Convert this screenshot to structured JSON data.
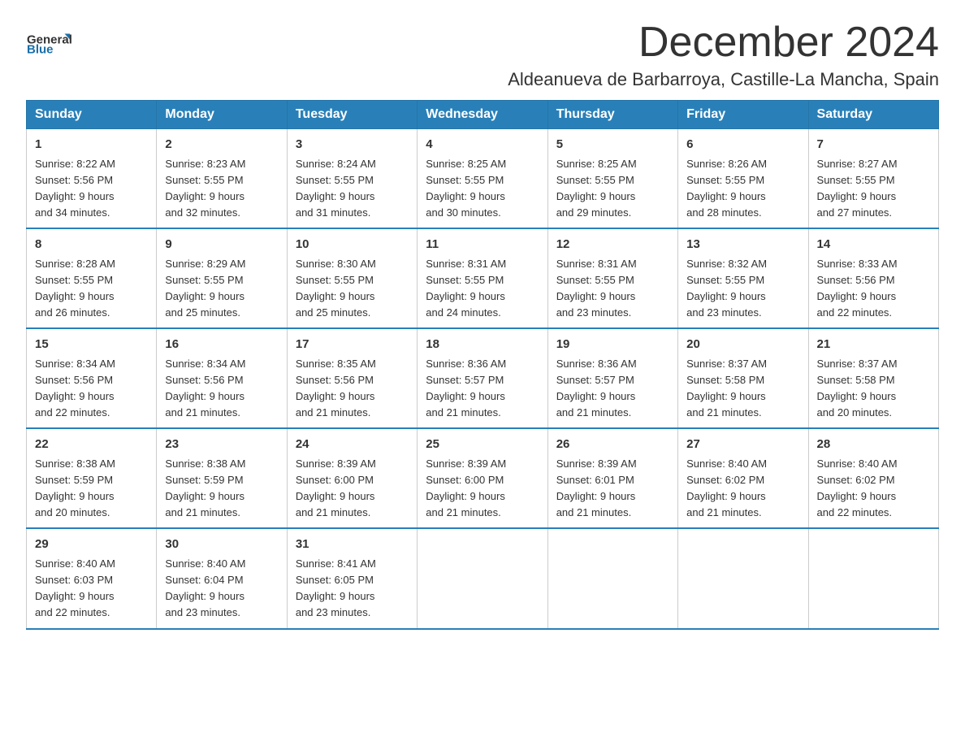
{
  "header": {
    "logo_general": "General",
    "logo_blue": "Blue",
    "month_title": "December 2024",
    "location": "Aldeanueva de Barbarroya, Castille-La Mancha, Spain"
  },
  "weekdays": [
    "Sunday",
    "Monday",
    "Tuesday",
    "Wednesday",
    "Thursday",
    "Friday",
    "Saturday"
  ],
  "weeks": [
    [
      {
        "day": "1",
        "sunrise": "8:22 AM",
        "sunset": "5:56 PM",
        "daylight": "9 hours and 34 minutes."
      },
      {
        "day": "2",
        "sunrise": "8:23 AM",
        "sunset": "5:55 PM",
        "daylight": "9 hours and 32 minutes."
      },
      {
        "day": "3",
        "sunrise": "8:24 AM",
        "sunset": "5:55 PM",
        "daylight": "9 hours and 31 minutes."
      },
      {
        "day": "4",
        "sunrise": "8:25 AM",
        "sunset": "5:55 PM",
        "daylight": "9 hours and 30 minutes."
      },
      {
        "day": "5",
        "sunrise": "8:25 AM",
        "sunset": "5:55 PM",
        "daylight": "9 hours and 29 minutes."
      },
      {
        "day": "6",
        "sunrise": "8:26 AM",
        "sunset": "5:55 PM",
        "daylight": "9 hours and 28 minutes."
      },
      {
        "day": "7",
        "sunrise": "8:27 AM",
        "sunset": "5:55 PM",
        "daylight": "9 hours and 27 minutes."
      }
    ],
    [
      {
        "day": "8",
        "sunrise": "8:28 AM",
        "sunset": "5:55 PM",
        "daylight": "9 hours and 26 minutes."
      },
      {
        "day": "9",
        "sunrise": "8:29 AM",
        "sunset": "5:55 PM",
        "daylight": "9 hours and 25 minutes."
      },
      {
        "day": "10",
        "sunrise": "8:30 AM",
        "sunset": "5:55 PM",
        "daylight": "9 hours and 25 minutes."
      },
      {
        "day": "11",
        "sunrise": "8:31 AM",
        "sunset": "5:55 PM",
        "daylight": "9 hours and 24 minutes."
      },
      {
        "day": "12",
        "sunrise": "8:31 AM",
        "sunset": "5:55 PM",
        "daylight": "9 hours and 23 minutes."
      },
      {
        "day": "13",
        "sunrise": "8:32 AM",
        "sunset": "5:55 PM",
        "daylight": "9 hours and 23 minutes."
      },
      {
        "day": "14",
        "sunrise": "8:33 AM",
        "sunset": "5:56 PM",
        "daylight": "9 hours and 22 minutes."
      }
    ],
    [
      {
        "day": "15",
        "sunrise": "8:34 AM",
        "sunset": "5:56 PM",
        "daylight": "9 hours and 22 minutes."
      },
      {
        "day": "16",
        "sunrise": "8:34 AM",
        "sunset": "5:56 PM",
        "daylight": "9 hours and 21 minutes."
      },
      {
        "day": "17",
        "sunrise": "8:35 AM",
        "sunset": "5:56 PM",
        "daylight": "9 hours and 21 minutes."
      },
      {
        "day": "18",
        "sunrise": "8:36 AM",
        "sunset": "5:57 PM",
        "daylight": "9 hours and 21 minutes."
      },
      {
        "day": "19",
        "sunrise": "8:36 AM",
        "sunset": "5:57 PM",
        "daylight": "9 hours and 21 minutes."
      },
      {
        "day": "20",
        "sunrise": "8:37 AM",
        "sunset": "5:58 PM",
        "daylight": "9 hours and 21 minutes."
      },
      {
        "day": "21",
        "sunrise": "8:37 AM",
        "sunset": "5:58 PM",
        "daylight": "9 hours and 20 minutes."
      }
    ],
    [
      {
        "day": "22",
        "sunrise": "8:38 AM",
        "sunset": "5:59 PM",
        "daylight": "9 hours and 20 minutes."
      },
      {
        "day": "23",
        "sunrise": "8:38 AM",
        "sunset": "5:59 PM",
        "daylight": "9 hours and 21 minutes."
      },
      {
        "day": "24",
        "sunrise": "8:39 AM",
        "sunset": "6:00 PM",
        "daylight": "9 hours and 21 minutes."
      },
      {
        "day": "25",
        "sunrise": "8:39 AM",
        "sunset": "6:00 PM",
        "daylight": "9 hours and 21 minutes."
      },
      {
        "day": "26",
        "sunrise": "8:39 AM",
        "sunset": "6:01 PM",
        "daylight": "9 hours and 21 minutes."
      },
      {
        "day": "27",
        "sunrise": "8:40 AM",
        "sunset": "6:02 PM",
        "daylight": "9 hours and 21 minutes."
      },
      {
        "day": "28",
        "sunrise": "8:40 AM",
        "sunset": "6:02 PM",
        "daylight": "9 hours and 22 minutes."
      }
    ],
    [
      {
        "day": "29",
        "sunrise": "8:40 AM",
        "sunset": "6:03 PM",
        "daylight": "9 hours and 22 minutes."
      },
      {
        "day": "30",
        "sunrise": "8:40 AM",
        "sunset": "6:04 PM",
        "daylight": "9 hours and 23 minutes."
      },
      {
        "day": "31",
        "sunrise": "8:41 AM",
        "sunset": "6:05 PM",
        "daylight": "9 hours and 23 minutes."
      },
      null,
      null,
      null,
      null
    ]
  ],
  "labels": {
    "sunrise": "Sunrise:",
    "sunset": "Sunset:",
    "daylight": "Daylight:"
  }
}
